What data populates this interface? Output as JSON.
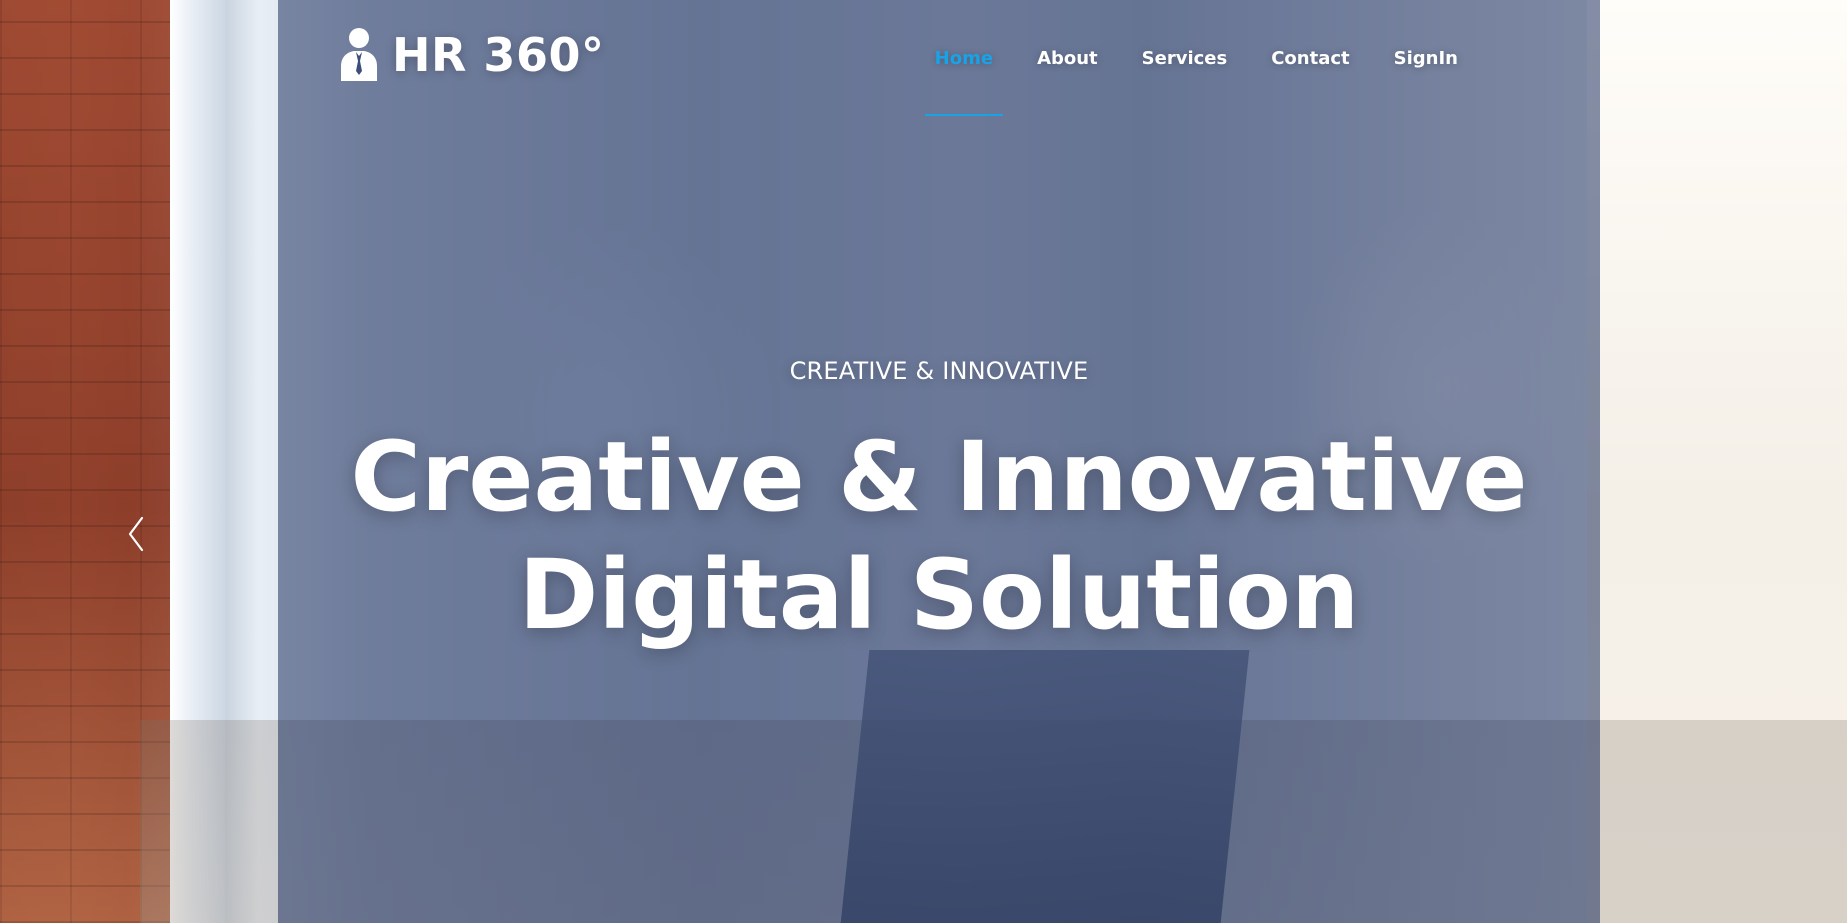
{
  "header": {
    "brand": {
      "name": "HR 360°",
      "icon": "person-in-suit-icon"
    },
    "nav": {
      "items": [
        {
          "label": "Home",
          "active": true
        },
        {
          "label": "About",
          "active": false
        },
        {
          "label": "Services",
          "active": false
        },
        {
          "label": "Contact",
          "active": false
        },
        {
          "label": "SignIn",
          "active": false
        }
      ]
    }
  },
  "hero": {
    "eyebrow": "CREATIVE & INNOVATIVE",
    "headline_lines": [
      "Creative & Innovative",
      "Digital Solution"
    ]
  },
  "carousel": {
    "prev_icon": "chevron-left-icon"
  },
  "colors": {
    "accent": "#19a3e6",
    "overlay": "#132758"
  }
}
